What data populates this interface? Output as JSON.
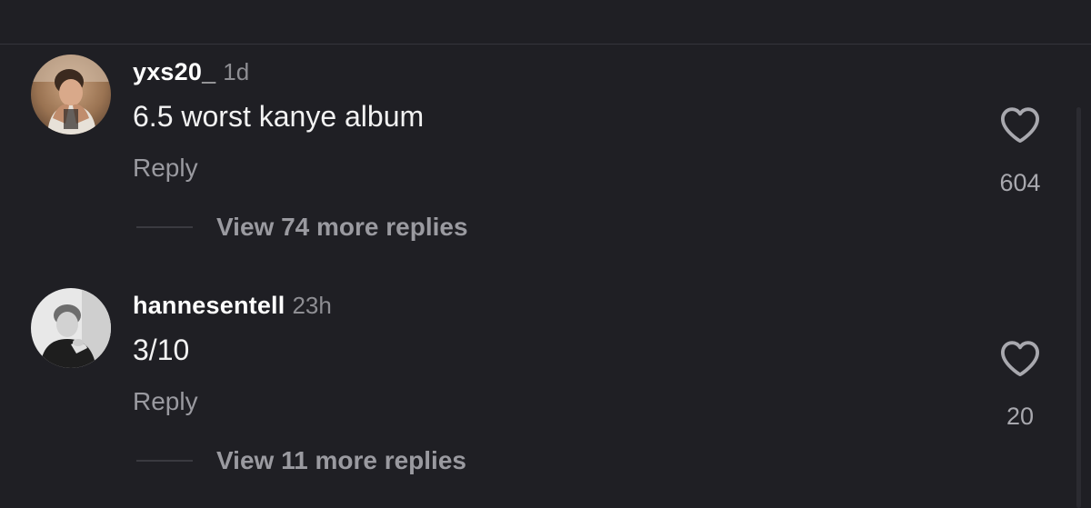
{
  "comments": [
    {
      "username": "yxs20_",
      "timestamp": "1d",
      "text": "6.5 worst kanye album",
      "reply_label": "Reply",
      "like_count": "604",
      "view_replies_label": "View 74 more replies",
      "avatar_icon": "user-avatar-photo"
    },
    {
      "username": "hannesentell",
      "timestamp": "23h",
      "text": "3/10",
      "reply_label": "Reply",
      "like_count": "20",
      "view_replies_label": "View 11 more replies",
      "avatar_icon": "user-avatar-photo-grayscale"
    }
  ],
  "colors": {
    "background": "#1f1f24",
    "primary_text": "#ffffff",
    "secondary_text": "#9a9aa0",
    "timestamp": "#8e8e93"
  }
}
